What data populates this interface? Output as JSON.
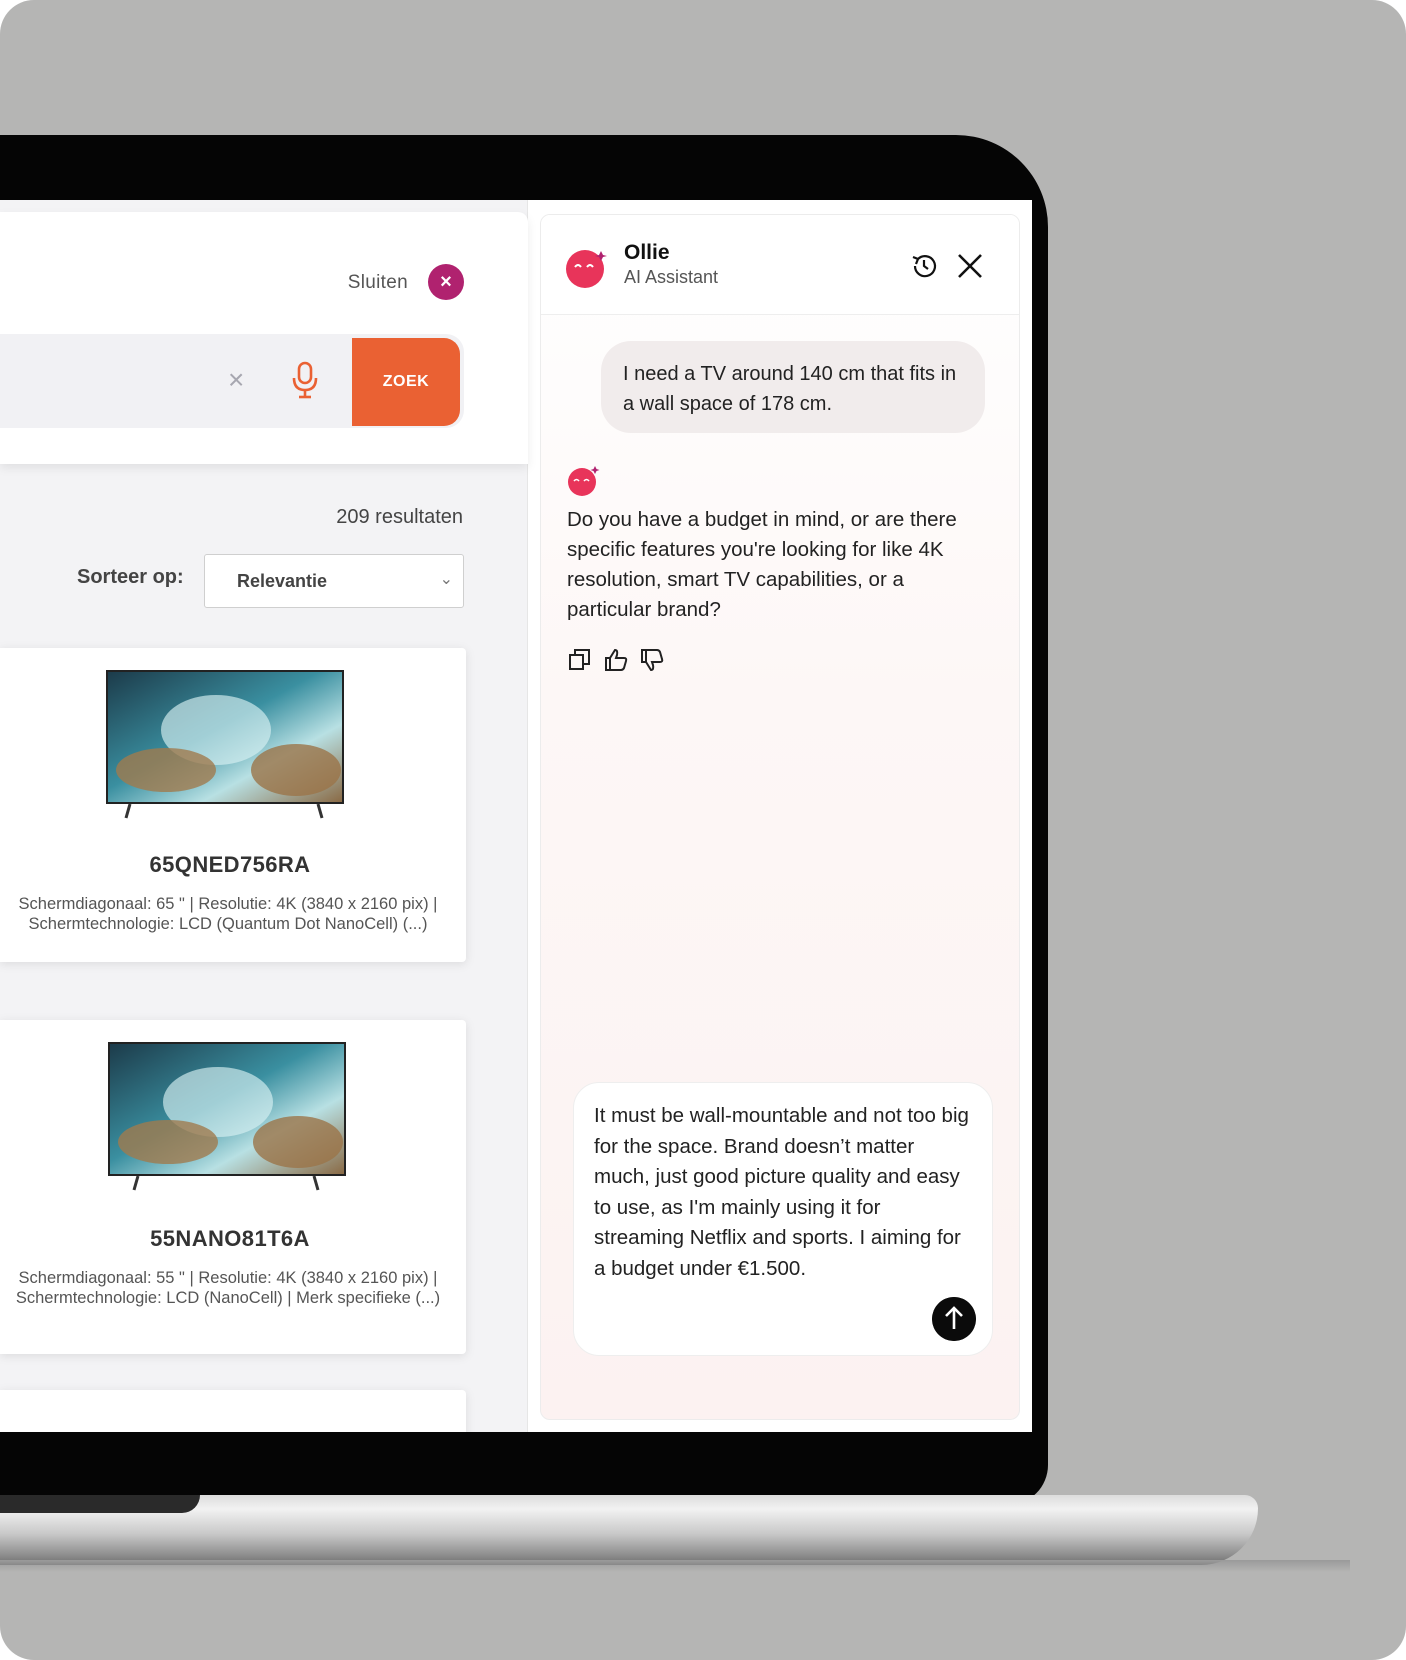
{
  "store": {
    "close_label": "Sluiten",
    "close_icon": "×",
    "search": {
      "clear_icon": "×",
      "button_label": "ZOEK"
    },
    "results_count": "209 resultaten",
    "sort": {
      "label": "Sorteer op:",
      "value": "Relevantie",
      "chevron": "⌄"
    },
    "products": [
      {
        "name": "65QNED756RA",
        "description": "Schermdiagonaal: 65 \" | Resolutie: 4K (3840 x 2160 pix) | Schermtechnologie: LCD (Quantum Dot NanoCell) (...)"
      },
      {
        "name": "55NANO81T6A",
        "description": "Schermdiagonaal: 55 \" | Resolutie: 4K (3840 x 2160 pix) | Schermtechnologie: LCD (NanoCell) | Merk specifieke (...)"
      }
    ]
  },
  "chat": {
    "assistant_name": "Ollie",
    "assistant_role": "AI Assistant",
    "messages": {
      "user": "I need a TV around 140 cm that fits in a wall space of 178 cm.",
      "assistant": "Do you have a budget in mind, or are there specific features you're looking for like 4K resolution, smart TV capabilities, or a particular brand?"
    },
    "compose_text": "It must be wall-mountable and not too big for the space. Brand doesn’t matter much, just good picture quality and easy to use, as I'm mainly using it for streaming Netflix and sports. I aiming for a budget under €1.500."
  },
  "colors": {
    "backdrop": "#b5b5b4",
    "accent_orange": "#ea6133",
    "close_magenta": "#b0226f",
    "avatar_pink": "#e8345a"
  },
  "icons": [
    "close-icon",
    "clear-icon",
    "microphone-icon",
    "chevron-down-icon",
    "history-icon",
    "copy-icon",
    "thumbs-up-icon",
    "thumbs-down-icon",
    "arrow-up-icon"
  ]
}
